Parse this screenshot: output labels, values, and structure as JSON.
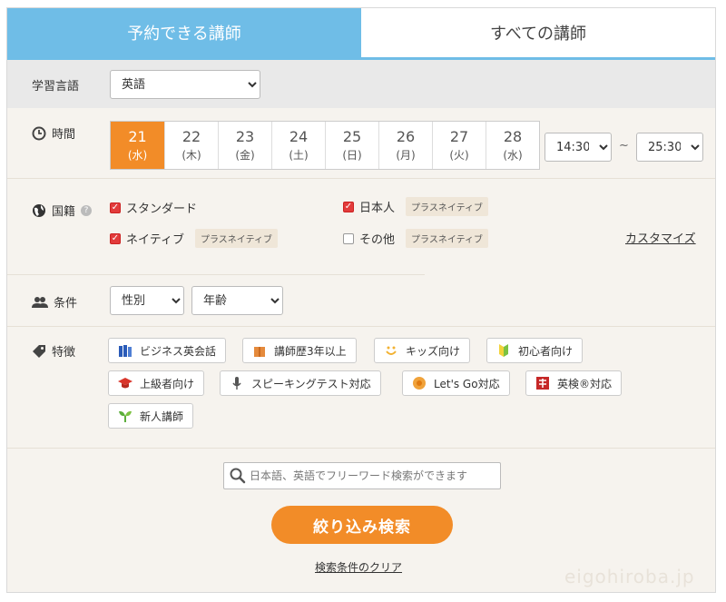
{
  "tabs": [
    {
      "label": "予約できる講師",
      "active": true
    },
    {
      "label": "すべての講師",
      "active": false
    }
  ],
  "language": {
    "label": "学習言語",
    "selected": "英語"
  },
  "time": {
    "label": "時間",
    "dates": [
      {
        "day": "21",
        "weekday": "(水)",
        "selected": true
      },
      {
        "day": "22",
        "weekday": "(木)"
      },
      {
        "day": "23",
        "weekday": "(金)"
      },
      {
        "day": "24",
        "weekday": "(土)"
      },
      {
        "day": "25",
        "weekday": "(日)"
      },
      {
        "day": "26",
        "weekday": "(月)"
      },
      {
        "day": "27",
        "weekday": "(火)"
      },
      {
        "day": "28",
        "weekday": "(水)"
      }
    ],
    "from": "14:30",
    "separator": "~",
    "to": "25:30"
  },
  "nationality": {
    "label": "国籍",
    "help": "?",
    "options": [
      {
        "label": "スタンダード",
        "checked": true,
        "badge": ""
      },
      {
        "label": "日本人",
        "checked": true,
        "badge": "プラスネイティブ"
      },
      {
        "label": "ネイティブ",
        "checked": true,
        "badge": "プラスネイティブ"
      },
      {
        "label": "その他",
        "checked": false,
        "badge": "プラスネイティブ"
      }
    ],
    "customize": "カスタマイズ"
  },
  "conditions": {
    "label": "条件",
    "gender": "性別",
    "age": "年齢"
  },
  "features": {
    "label": "特徴",
    "items": [
      {
        "label": "ビジネス英会話",
        "icon": "books-icon",
        "color": "#2a5bb8"
      },
      {
        "label": "講師歴3年以上",
        "icon": "gift-box-icon",
        "color": "#e58a3c"
      },
      {
        "label": "キッズ向け",
        "icon": "smile-icon",
        "color": "#f2b233"
      },
      {
        "label": "初心者向け",
        "icon": "beginner-mark-icon",
        "color": "#7cc242"
      },
      {
        "label": "上級者向け",
        "icon": "graduation-cap-icon",
        "color": "#d9362b"
      },
      {
        "label": "スピーキングテスト対応",
        "icon": "microphone-icon",
        "color": "#555555"
      },
      {
        "label": "Let's Go対応",
        "icon": "lets-go-icon",
        "color": "#f0a23a"
      },
      {
        "label": "英検®対応",
        "icon": "eiken-icon",
        "color": "#c62828"
      },
      {
        "label": "新人講師",
        "icon": "sprout-icon",
        "color": "#5cae3c"
      }
    ]
  },
  "search": {
    "placeholder": "日本語、英語でフリーワード検索ができます",
    "value": ""
  },
  "buttons": {
    "submit": "絞り込み検索",
    "clear": "検索条件のクリア"
  },
  "watermark": "eigohiroba.jp",
  "colors": {
    "accent": "#f28c28",
    "tab_active": "#6fbde7",
    "check": "#e23b3b"
  }
}
